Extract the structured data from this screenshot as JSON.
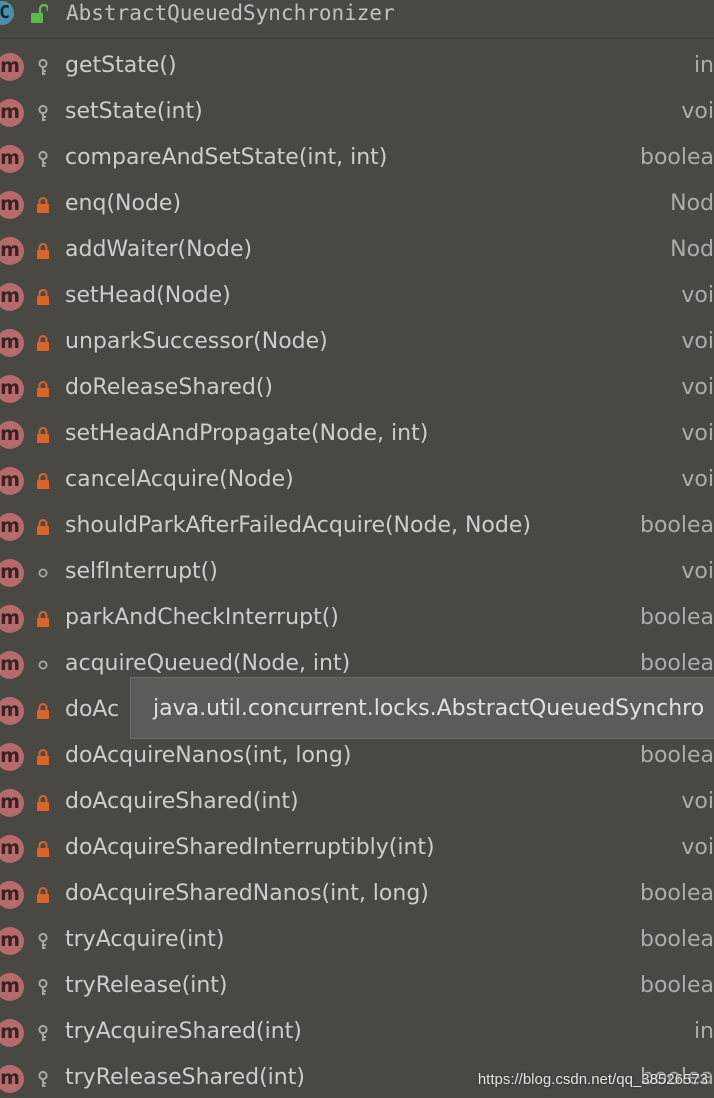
{
  "header": {
    "class_icon_letter": "C",
    "title": "AbstractQueuedSynchronizer"
  },
  "method_icon_letter": "m",
  "methods": [
    {
      "signature": "getState()",
      "return_type": "in",
      "visibility": "protected"
    },
    {
      "signature": "setState(int)",
      "return_type": "voi",
      "visibility": "protected"
    },
    {
      "signature": "compareAndSetState(int, int)",
      "return_type": "boolea",
      "visibility": "protected"
    },
    {
      "signature": "enq(Node)",
      "return_type": "Nod",
      "visibility": "private"
    },
    {
      "signature": "addWaiter(Node)",
      "return_type": "Nod",
      "visibility": "private"
    },
    {
      "signature": "setHead(Node)",
      "return_type": "voi",
      "visibility": "private"
    },
    {
      "signature": "unparkSuccessor(Node)",
      "return_type": "voi",
      "visibility": "private"
    },
    {
      "signature": "doReleaseShared()",
      "return_type": "voi",
      "visibility": "private"
    },
    {
      "signature": "setHeadAndPropagate(Node, int)",
      "return_type": "voi",
      "visibility": "private"
    },
    {
      "signature": "cancelAcquire(Node)",
      "return_type": "voi",
      "visibility": "private"
    },
    {
      "signature": "shouldParkAfterFailedAcquire(Node, Node)",
      "return_type": "boolea",
      "visibility": "private"
    },
    {
      "signature": "selfInterrupt()",
      "return_type": "voi",
      "visibility": "package"
    },
    {
      "signature": "parkAndCheckInterrupt()",
      "return_type": "boolea",
      "visibility": "private"
    },
    {
      "signature": "acquireQueued(Node, int)",
      "return_type": "boolea",
      "visibility": "package"
    },
    {
      "signature": "doAc",
      "return_type": "",
      "visibility": "private"
    },
    {
      "signature": "doAcquireNanos(int, long)",
      "return_type": "boolea",
      "visibility": "private"
    },
    {
      "signature": "doAcquireShared(int)",
      "return_type": "voi",
      "visibility": "private"
    },
    {
      "signature": "doAcquireSharedInterruptibly(int)",
      "return_type": "voi",
      "visibility": "private"
    },
    {
      "signature": "doAcquireSharedNanos(int, long)",
      "return_type": "boolea",
      "visibility": "private"
    },
    {
      "signature": "tryAcquire(int)",
      "return_type": "boolea",
      "visibility": "protected"
    },
    {
      "signature": "tryRelease(int)",
      "return_type": "boolea",
      "visibility": "protected"
    },
    {
      "signature": "tryAcquireShared(int)",
      "return_type": "in",
      "visibility": "protected"
    },
    {
      "signature": "tryReleaseShared(int)",
      "return_type": "boolea",
      "visibility": "protected"
    }
  ],
  "tooltip": {
    "text": "java.util.concurrent.locks.AbstractQueuedSynchro"
  },
  "watermark": "https://blog.csdn.net/qq_38526573",
  "colors": {
    "background": "#4a4843",
    "method_icon": "#b56b6b",
    "class_icon": "#4d8ea8",
    "private_lock": "#d9652b",
    "public_unlock": "#5fb94a"
  }
}
